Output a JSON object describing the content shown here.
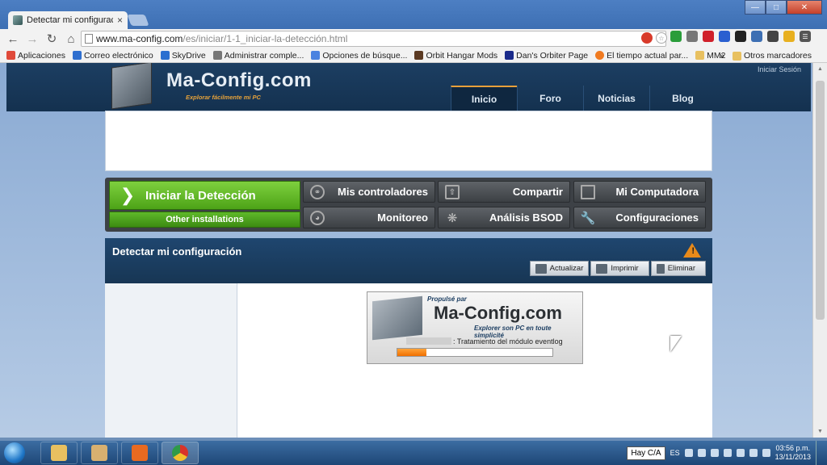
{
  "browser": {
    "tab_title": "Detectar mi configuración",
    "tab_close": "×",
    "url_host": "www.ma-config.com",
    "url_path": "/es/iniciar/1-1_iniciar-la-detección.html",
    "window_min": "—",
    "window_max": "□",
    "window_close": "✕"
  },
  "bookmarks": {
    "items": [
      {
        "label": "Aplicaciones",
        "color": "#e04a3a"
      },
      {
        "label": "Correo electrónico",
        "color": "#2f6fcf"
      },
      {
        "label": "SkyDrive",
        "color": "#2a6fd0"
      },
      {
        "label": "Administrar comple...",
        "color": "#777777"
      },
      {
        "label": "Opciones de búsque...",
        "color": "#4b83e0"
      },
      {
        "label": "Orbit Hangar Mods",
        "color": "#5b3a22"
      },
      {
        "label": "Dan's Orbiter Page",
        "color": "#1a2a8a"
      },
      {
        "label": "El tiempo actual par...",
        "color": "#f07a20"
      },
      {
        "label": "MM2",
        "color": "#e8c060"
      }
    ],
    "overflow": "»",
    "others": "Otros marcadores"
  },
  "site": {
    "logo": "Ma-Config.com",
    "tagline": "Explorar fácilmente mi PC",
    "login": "Iniciar Sesión",
    "nav": [
      {
        "label": "Inicio",
        "active": true
      },
      {
        "label": "Foro",
        "active": false
      },
      {
        "label": "Noticias",
        "active": false
      },
      {
        "label": "Blog",
        "active": false
      }
    ]
  },
  "actions": {
    "detect": "Iniciar la Detección",
    "other": "Other installations",
    "drivers": "Mis controladores",
    "share": "Compartir",
    "computer": "Mi Computadora",
    "monitoring": "Monitoreo",
    "bsod": "Análisis BSOD",
    "settings": "Configuraciones"
  },
  "panel": {
    "title": "Detectar mi configuración",
    "warn": "!",
    "refresh": "Actualizar",
    "print": "Imprimir",
    "delete": "Eliminar"
  },
  "loader": {
    "propulse": "Propulsé par",
    "logo": "Ma-Config.com",
    "tagline": "Explorer son PC en toute simplicité",
    "status": ": Tratamiento del módulo eventlog",
    "progress": 0.19
  },
  "taskbar": {
    "tooltip": "Hay C/A",
    "lang": "ES",
    "time": "03:56 p.m.",
    "date": "13/11/2013"
  }
}
